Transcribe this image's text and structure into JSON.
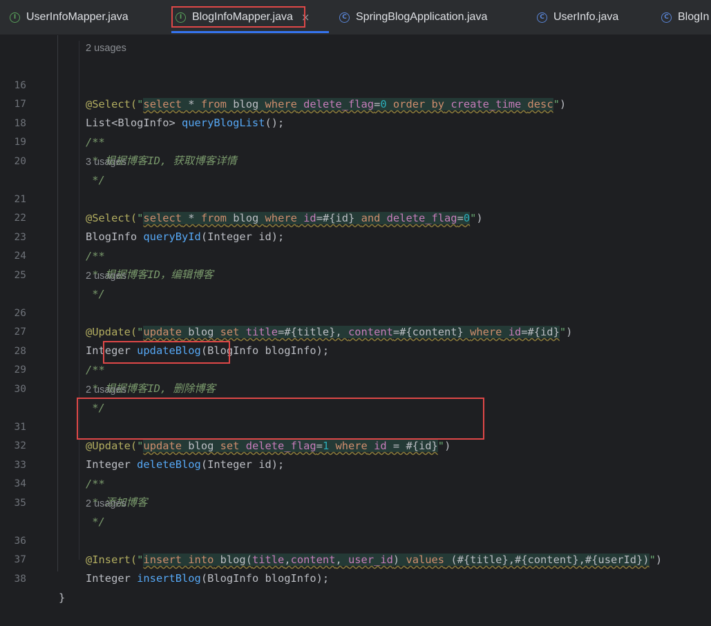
{
  "tabs": [
    {
      "label": "UserInfoMapper.java",
      "icon": "interface-icon",
      "active": false
    },
    {
      "label": "BlogInfoMapper.java",
      "icon": "interface-icon",
      "active": true
    },
    {
      "label": "SpringBlogApplication.java",
      "icon": "spring-boot-class-icon",
      "active": false
    },
    {
      "label": "UserInfo.java",
      "icon": "class-icon",
      "active": false
    },
    {
      "label": "BlogIn",
      "icon": "class-icon",
      "active": false
    }
  ],
  "close_glyph": "×",
  "usages": {
    "u1": "2 usages",
    "u2": "3 usages",
    "u3": "2 usages",
    "u4": "2 usages",
    "u5": "2 usages"
  },
  "lines": {
    "n16": "16",
    "n17": "17",
    "n18": "18",
    "n19": "19",
    "n20": "20",
    "n21": "21",
    "n22": "22",
    "n23": "23",
    "n24": "24",
    "n25": "25",
    "n26": "26",
    "n27": "27",
    "n28": "28",
    "n29": "29",
    "n30": "30",
    "n31": "31",
    "n32": "32",
    "n33": "33",
    "n34": "34",
    "n35": "35",
    "n36": "36",
    "n37": "37",
    "n38": "38"
  },
  "code": {
    "l16_ann": "@Select(",
    "l16_q1": "\"",
    "l16_s1": "select",
    "l16_s2": " * ",
    "l16_s3": "from",
    "l16_s4": " blog ",
    "l16_s5": "where",
    "l16_s6": " delete_flag",
    "l16_s7": "=",
    "l16_s8": "0",
    "l16_s9": " order by",
    "l16_s10": " create_time ",
    "l16_s11": "desc",
    "l16_q2": "\"",
    "l16_end": ")",
    "l17_a": "List<BlogInfo> ",
    "l17_fn": "queryBlogList",
    "l17_b": "();",
    "l18": "/**",
    "l19": " * 根据博客ID, 获取博客详情",
    "l20": " */",
    "l21_ann": "@Select(",
    "l21_q1": "\"",
    "l21_s1": "select",
    "l21_s2": " * ",
    "l21_s3": "from",
    "l21_s4": " blog ",
    "l21_s5": "where",
    "l21_s6": " id",
    "l21_s7": "=#{id} ",
    "l21_s8": "and",
    "l21_s9": " delete_flag",
    "l21_s10": "=",
    "l21_s11": "0",
    "l21_q2": "\"",
    "l21_end": ")",
    "l22_a": "BlogInfo ",
    "l22_fn": "queryById",
    "l22_b": "(Integer id);",
    "l23": "/**",
    "l24": " * 根据博客ID，编辑博客",
    "l25": " */",
    "l26_ann": "@Update(",
    "l26_q1": "\"",
    "l26_s1": "update",
    "l26_s2": " blog ",
    "l26_s3": "set",
    "l26_s4": " title",
    "l26_s5": "=#{title}, ",
    "l26_s6": "content",
    "l26_s7": "=#{content} ",
    "l26_s8": "where",
    "l26_s9": " id",
    "l26_s10": "=#{id}",
    "l26_q2": "\"",
    "l26_end": ")",
    "l27_a": "Integer ",
    "l27_fn": "updateBlog",
    "l27_b": "(BlogInfo blogInfo);",
    "l28": "/**",
    "l29_a": " * ",
    "l29_b": "根据博客ID, 删除博客",
    "l30": " */",
    "l31_ann": "@Update(",
    "l31_q1": "\"",
    "l31_s1": "update",
    "l31_s2": " blog ",
    "l31_s3": "set",
    "l31_s4": " delete_flag",
    "l31_s5": "=",
    "l31_s6": "1",
    "l31_s7": " where",
    "l31_s8": " id",
    "l31_s9": " = #{id}",
    "l31_q2": "\"",
    "l31_end": ")",
    "l32_a": "Integer ",
    "l32_fn": "deleteBlog",
    "l32_b": "(Integer id);",
    "l33": "/**",
    "l34": " * 添加博客",
    "l35": " */",
    "l36_ann": "@Insert(",
    "l36_q1": "\"",
    "l36_s1": "insert into",
    "l36_s2": " blog(",
    "l36_s3": "title",
    "l36_s4": ",",
    "l36_s5": "content",
    "l36_s6": ", ",
    "l36_s7": "user_id",
    "l36_s8": ") ",
    "l36_s9": "values",
    "l36_s10": " (#{title},#{content},#{userId})",
    "l36_q2": "\"",
    "l36_end": ")",
    "l37_a": "Integer ",
    "l37_fn": "insertBlog",
    "l37_b": "(BlogInfo blogInfo);",
    "l38": "}"
  },
  "colors": {
    "background": "#1e1f22",
    "annotation": "#b3ae60",
    "string": "#6aab73",
    "keyword": "#cf8e6d",
    "method": "#56a8f5",
    "comment": "#7a9a6c",
    "highlight_box": "#e04848",
    "active_tab_underline": "#3574f0"
  }
}
